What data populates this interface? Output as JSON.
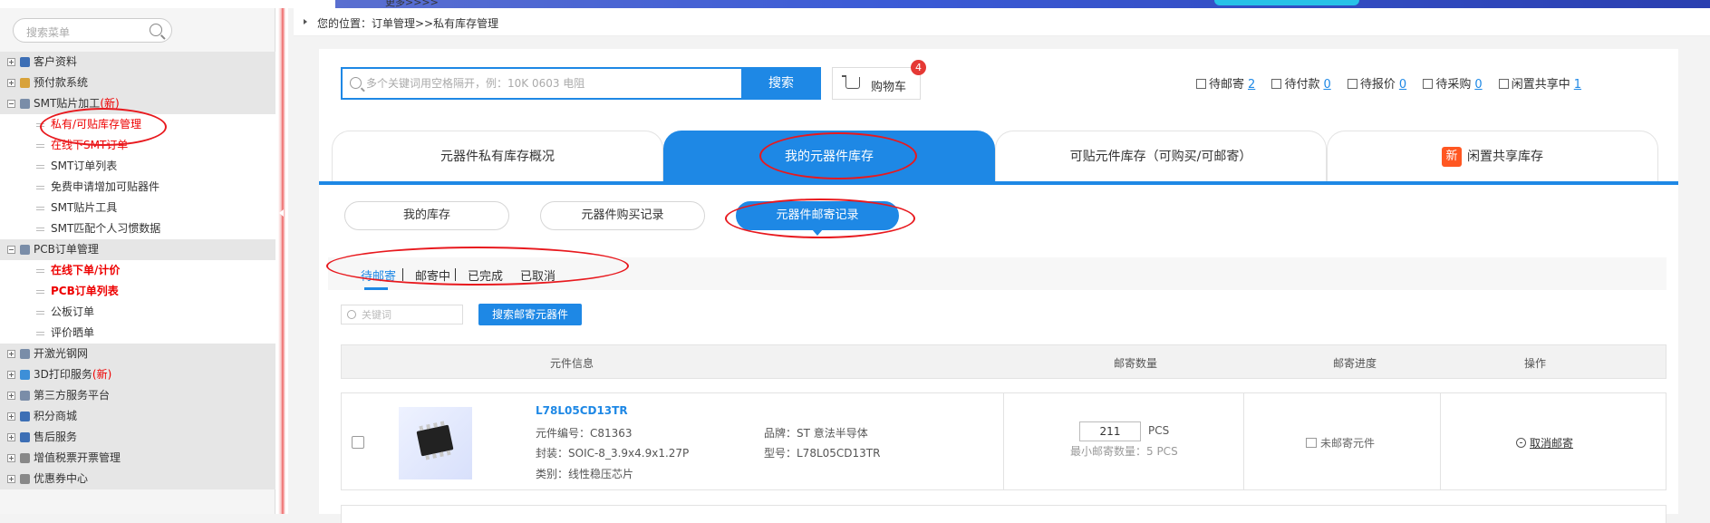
{
  "top": {
    "more_label": "更多>>>>"
  },
  "sidebar": {
    "search_placeholder": "搜索菜单",
    "items": [
      {
        "label": "客户资料",
        "type": "group",
        "icon": "user-icon",
        "color": "#3d6fb5"
      },
      {
        "label": "预付款系统",
        "type": "group",
        "icon": "wallet-icon",
        "color": "#d8a23a"
      },
      {
        "label": "SMT贴片加工",
        "new": "(新)",
        "type": "group-open",
        "icon": "grid-icon",
        "color": "#7a8da8"
      },
      {
        "label": "私有/可贴库存管理",
        "type": "sub",
        "red": true
      },
      {
        "label": "在线下SMT订单",
        "type": "sub",
        "red": true
      },
      {
        "label": "SMT订单列表",
        "type": "sub"
      },
      {
        "label": "免费申请增加可贴器件",
        "type": "sub"
      },
      {
        "label": "SMT贴片工具",
        "type": "sub"
      },
      {
        "label": "SMT匹配个人习惯数据",
        "type": "sub"
      },
      {
        "label": "PCB订单管理",
        "type": "group-open",
        "icon": "grid-icon",
        "color": "#7a8da8"
      },
      {
        "label": "在线下单/计价",
        "type": "sub",
        "red": true,
        "bold": true
      },
      {
        "label": "PCB订单列表",
        "type": "sub",
        "red": true,
        "bold": true
      },
      {
        "label": "公板订单",
        "type": "sub"
      },
      {
        "label": "评价晒单",
        "type": "sub"
      },
      {
        "label": "开激光钢网",
        "type": "group",
        "icon": "grid-icon",
        "color": "#7a8da8"
      },
      {
        "label": "3D打印服务",
        "new": "(新)",
        "type": "group",
        "icon": "cube-icon",
        "color": "#3d8fd8"
      },
      {
        "label": "第三方服务平台",
        "type": "group",
        "icon": "grid-icon",
        "color": "#7a8da8"
      },
      {
        "label": "积分商城",
        "type": "group",
        "icon": "shield-icon",
        "color": "#3d6fb5"
      },
      {
        "label": "售后服务",
        "type": "group",
        "icon": "person-icon",
        "color": "#3d6fb5"
      },
      {
        "label": "增值税票开票管理",
        "type": "group",
        "icon": "doc-icon",
        "color": "#888888"
      },
      {
        "label": "优惠券中心",
        "type": "group",
        "icon": "ticket-icon",
        "color": "#888888"
      }
    ]
  },
  "breadcrumb": {
    "text": "您的位置：订单管理>>私有库存管理"
  },
  "search": {
    "placeholder": "多个关键词用空格隔开，例：10K 0603 电阻",
    "button_label": "搜索",
    "cart_label": "购物车",
    "cart_count": "4"
  },
  "stats": [
    {
      "label": "待邮寄",
      "value": "2"
    },
    {
      "label": "待付款",
      "value": "0"
    },
    {
      "label": "待报价",
      "value": "0"
    },
    {
      "label": "待采购",
      "value": "0"
    },
    {
      "label": "闲置共享中",
      "value": "1"
    }
  ],
  "big_tabs": {
    "t1": "元器件私有库存概况",
    "t2": "我的元器件库存",
    "t3": "可贴元件库存（可购买/可邮寄）",
    "t4_tag": "新",
    "t4": "闲置共享库存"
  },
  "sub_tabs": {
    "s1": "我的库存",
    "s2": "元器件购买记录",
    "s3": "元器件邮寄记录"
  },
  "status_tabs": {
    "a": "待邮寄",
    "b": "邮寄中",
    "c": "已完成",
    "d": "已取消"
  },
  "filter": {
    "keyword_placeholder": "关键词",
    "button_label": "搜索邮寄元器件"
  },
  "table": {
    "headers": [
      "元件信息",
      "邮寄数量",
      "邮寄进度",
      "操作"
    ],
    "rows": [
      {
        "part_number": "L78L05CD13TR",
        "code": "元件编号：C81363",
        "package": "封装：SOIC-8_3.9x4.9x1.27P",
        "category": "类别：线性稳压芯片",
        "brand": "品牌：ST 意法半导体",
        "model": "型号：L78L05CD13TR",
        "qty": "211",
        "unit": "PCS",
        "min_qty": "最小邮寄数量：5 PCS",
        "progress": "未邮寄元件",
        "action": "取消邮寄"
      }
    ]
  },
  "colors": {
    "accent": "#1e88e5",
    "annotation": "#e8191e",
    "badge": "#e53935",
    "new_tag": "#ff5722"
  }
}
